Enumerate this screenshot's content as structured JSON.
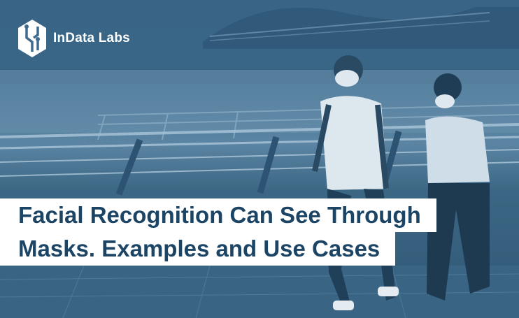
{
  "brand": {
    "name": "InData Labs",
    "logo_icon": "indata-labs-logo-icon"
  },
  "headline": {
    "line_1": "Facial Recognition Can See Through",
    "line_2": "Masks. Examples and Use Cases"
  },
  "colors": {
    "overlay": "#3f6c8e",
    "headline_text": "#1c4464",
    "headline_bg": "#ffffff",
    "logo_text": "#ffffff"
  },
  "photo": {
    "icon": "masked-pedestrians-photo"
  }
}
